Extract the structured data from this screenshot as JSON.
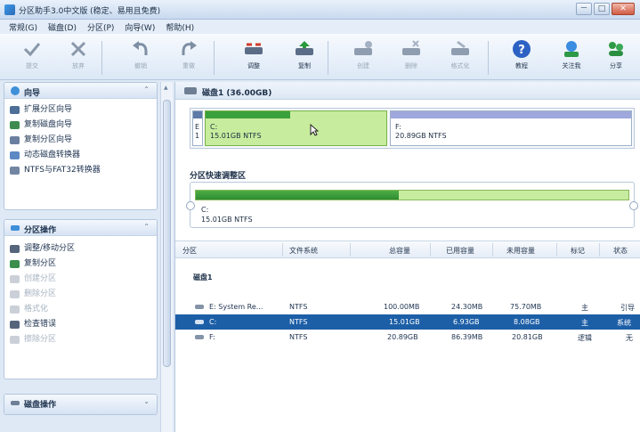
{
  "window": {
    "title": "分区助手3.0中文版 (稳定、易用且免费)",
    "controls": [
      "－",
      "□",
      "✕"
    ]
  },
  "menu": [
    "常规(G)",
    "磁盘(D)",
    "分区(P)",
    "向导(W)",
    "帮助(H)"
  ],
  "toolbar": [
    {
      "label": "提交",
      "icon": "apply-check-icon",
      "enabled": false
    },
    {
      "label": "放弃",
      "icon": "discard-x-icon",
      "enabled": false
    },
    {
      "label": "撤销",
      "icon": "undo-icon",
      "enabled": false
    },
    {
      "label": "重做",
      "icon": "redo-icon",
      "enabled": false
    },
    {
      "label": "调整",
      "icon": "resize-partition-icon",
      "enabled": true
    },
    {
      "label": "复制",
      "icon": "copy-partition-icon",
      "enabled": true
    },
    {
      "label": "创建",
      "icon": "create-partition-icon",
      "enabled": false
    },
    {
      "label": "删除",
      "icon": "delete-partition-icon",
      "enabled": false
    },
    {
      "label": "格式化",
      "icon": "format-icon",
      "enabled": false
    },
    {
      "label": "教程",
      "icon": "help-question-icon",
      "enabled": true
    },
    {
      "label": "关注我",
      "icon": "follow-icon",
      "enabled": true
    },
    {
      "label": "分享",
      "icon": "share-icon",
      "enabled": true
    }
  ],
  "sidebar": {
    "wizard": {
      "title": "向导",
      "items": [
        {
          "label": "扩展分区向导",
          "enabled": true
        },
        {
          "label": "复制磁盘向导",
          "enabled": true
        },
        {
          "label": "复制分区向导",
          "enabled": true
        },
        {
          "label": "动态磁盘转换器",
          "enabled": true
        },
        {
          "label": "NTFS与FAT32转换器",
          "enabled": true
        }
      ]
    },
    "partition_ops": {
      "title": "分区操作",
      "items": [
        {
          "label": "调整/移动分区",
          "enabled": true
        },
        {
          "label": "复制分区",
          "enabled": true
        },
        {
          "label": "创建分区",
          "enabled": false
        },
        {
          "label": "删除分区",
          "enabled": false
        },
        {
          "label": "格式化",
          "enabled": false
        },
        {
          "label": "检查错误",
          "enabled": true
        },
        {
          "label": "擦除分区",
          "enabled": false
        }
      ]
    },
    "disk_ops": {
      "title": "磁盘操作"
    }
  },
  "disk": {
    "title": "磁盘1 (36.00GB)",
    "map": {
      "sys": {
        "top": "E",
        "bottom": "1"
      },
      "c": {
        "name": "C:",
        "size": "15.01GB NTFS",
        "used_fraction": 0.47
      },
      "f": {
        "name": "F:",
        "size": "20.89GB NTFS"
      }
    }
  },
  "resizer": {
    "title": "分区快速调整区",
    "name": "C:",
    "size": "15.01GB NTFS",
    "used_fraction": 0.47
  },
  "grid": {
    "columns": [
      "分区",
      "文件系统",
      "总容量",
      "已用容量",
      "未用容量",
      "标记",
      "状态"
    ],
    "group": "磁盘1",
    "rows": [
      {
        "partition": "E: System Re...",
        "fs": "NTFS",
        "total": "100.00MB",
        "used": "24.30MB",
        "free": "75.70MB",
        "flag": "主",
        "status": "引导",
        "selected": false
      },
      {
        "partition": "C:",
        "fs": "NTFS",
        "total": "15.01GB",
        "used": "6.93GB",
        "free": "8.08GB",
        "flag": "主",
        "status": "系统",
        "selected": true
      },
      {
        "partition": "F:",
        "fs": "NTFS",
        "total": "20.89GB",
        "used": "86.39MB",
        "free": "20.81GB",
        "flag": "逻辑",
        "status": "无",
        "selected": false
      }
    ]
  },
  "colors": {
    "selected_row": "#1d5fa7",
    "partition_green": "#3aa03c",
    "partition_light_green": "#c7ec9d",
    "logical_bar": "#9ea8dc",
    "system_bar": "#5d7aa8"
  }
}
